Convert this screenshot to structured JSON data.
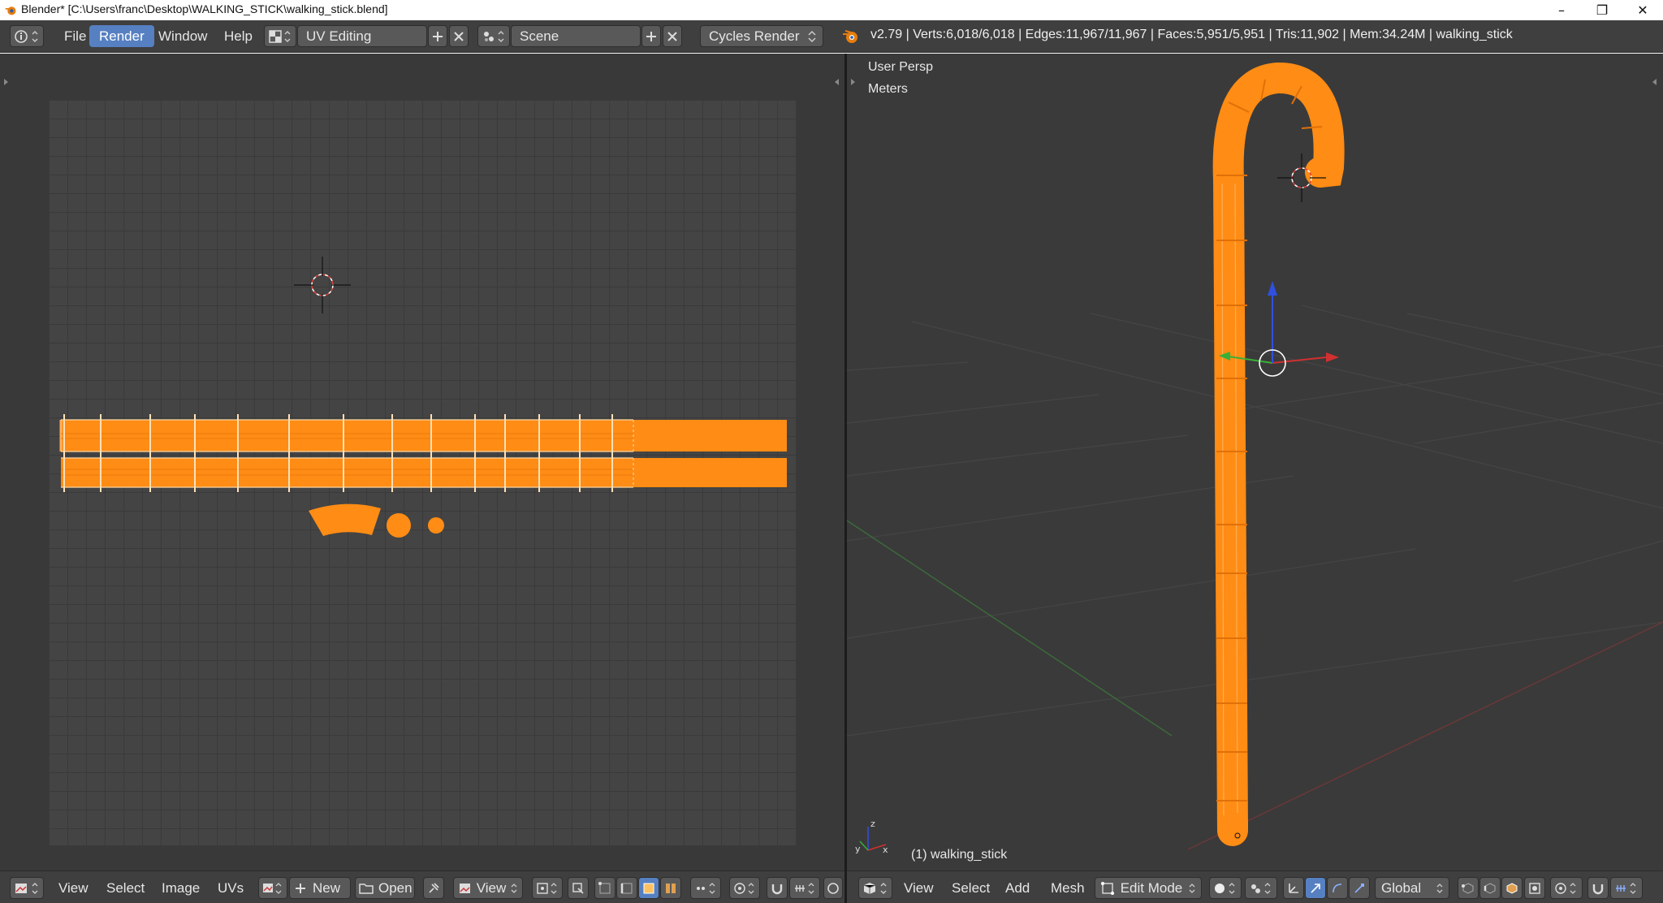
{
  "window": {
    "title": "Blender* [C:\\Users\\franc\\Desktop\\WALKING_STICK\\walking_stick.blend]",
    "minimize_glyph": "–",
    "maximize_glyph": "❐",
    "close_glyph": "✕"
  },
  "info_header": {
    "menu": [
      "File",
      "Render",
      "Window",
      "Help"
    ],
    "active_menu": "Render",
    "screen_layout": "UV Editing",
    "scene": "Scene",
    "render_engine": "Cycles Render",
    "stats": "v2.79 | Verts:6,018/6,018 | Edges:11,967/11,967 | Faces:5,951/5,951 | Tris:11,902 | Mem:34.24M | walking_stick"
  },
  "uv_editor": {
    "header": {
      "menu": [
        "View",
        "Select",
        "Image",
        "UVs"
      ],
      "new_label": "New",
      "open_label": "Open",
      "view_label": "View"
    }
  },
  "viewport": {
    "view_label": "User Persp",
    "units_label": "Meters",
    "object_label": "(1) walking_stick",
    "header": {
      "menu": [
        "View",
        "Select",
        "Add",
        "Mesh"
      ],
      "mode": "Edit Mode",
      "orientation": "Global"
    }
  },
  "colors": {
    "selection_orange": "#ff8c14",
    "header_bg": "#3f3f3f",
    "active_blue": "#5680c2",
    "axis_x": "#d03030",
    "axis_y": "#38b038",
    "axis_z": "#3050e0"
  }
}
